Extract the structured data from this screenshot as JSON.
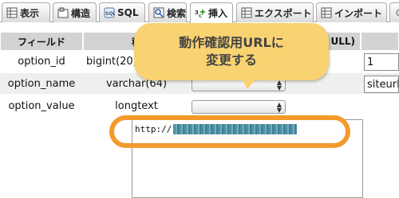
{
  "tabs": [
    {
      "label": "表示",
      "icon": "browse-table-icon"
    },
    {
      "label": "構造",
      "icon": "structure-icon"
    },
    {
      "label": "SQL",
      "icon": "sql-icon"
    },
    {
      "label": "検索",
      "icon": "search-icon"
    },
    {
      "label": "挿入",
      "icon": "insert-icon"
    },
    {
      "label": "エクスポート",
      "icon": "export-icon"
    },
    {
      "label": "インポート",
      "icon": "import-icon"
    },
    {
      "label": "",
      "icon": "more-icon"
    }
  ],
  "active_tab": "挿入",
  "table": {
    "headers": {
      "field": "フィールド",
      "type": "種",
      "null": "ULL)"
    },
    "rows": [
      {
        "field": "option_id",
        "type": "bigint(20)",
        "value": "1"
      },
      {
        "field": "option_name",
        "type": "varchar(64)",
        "value": "siteurl"
      },
      {
        "field": "option_value",
        "type": "longtext",
        "value": "http://"
      }
    ]
  },
  "callout": {
    "line1": "動作確認用URLに",
    "line2": "変更する"
  },
  "colors": {
    "highlight_ring": "#f39a2c",
    "callout_bg": "#f9d271",
    "header_bg": "#d3d3d3"
  }
}
